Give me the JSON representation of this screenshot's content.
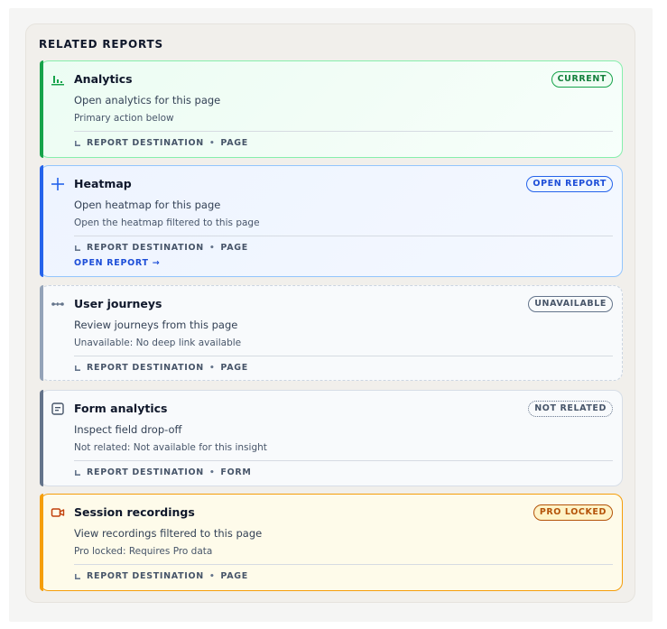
{
  "panel": {
    "title": "RELATED REPORTS"
  },
  "reports": [
    {
      "icon": "bar-chart-icon",
      "title": "Analytics",
      "badge": "CURRENT",
      "description": "Open analytics for this page",
      "subtext": "Primary action below",
      "meta_label": "REPORT DESTINATION",
      "meta_scope": "PAGE"
    },
    {
      "icon": "plus-icon",
      "title": "Heatmap",
      "badge": "OPEN REPORT",
      "description": "Open heatmap for this page",
      "subtext": "Open the heatmap filtered to this page",
      "meta_label": "REPORT DESTINATION",
      "meta_scope": "PAGE",
      "link": "OPEN REPORT →"
    },
    {
      "icon": "journey-path-icon",
      "title": "User journeys",
      "badge": "UNAVAILABLE",
      "description": "Review journeys from this page",
      "subtext": "Unavailable: No deep link available",
      "meta_label": "REPORT DESTINATION",
      "meta_scope": "PAGE"
    },
    {
      "icon": "form-icon",
      "title": "Form analytics",
      "badge": "NOT RELATED",
      "description": "Inspect field drop-off",
      "subtext": "Not related: Not available for this insight",
      "meta_label": "REPORT DESTINATION",
      "meta_scope": "FORM"
    },
    {
      "icon": "video-camera-icon",
      "title": "Session recordings",
      "badge": "PRO LOCKED",
      "description": "View recordings filtered to this page",
      "subtext": "Pro locked: Requires Pro data",
      "meta_label": "REPORT DESTINATION",
      "meta_scope": "PAGE"
    }
  ],
  "colors": {
    "current": "#16a34a",
    "open": "#2563eb",
    "unavailable": "#94a3b8",
    "not_related": "#64748b",
    "pro_locked": "#f59e0b"
  }
}
